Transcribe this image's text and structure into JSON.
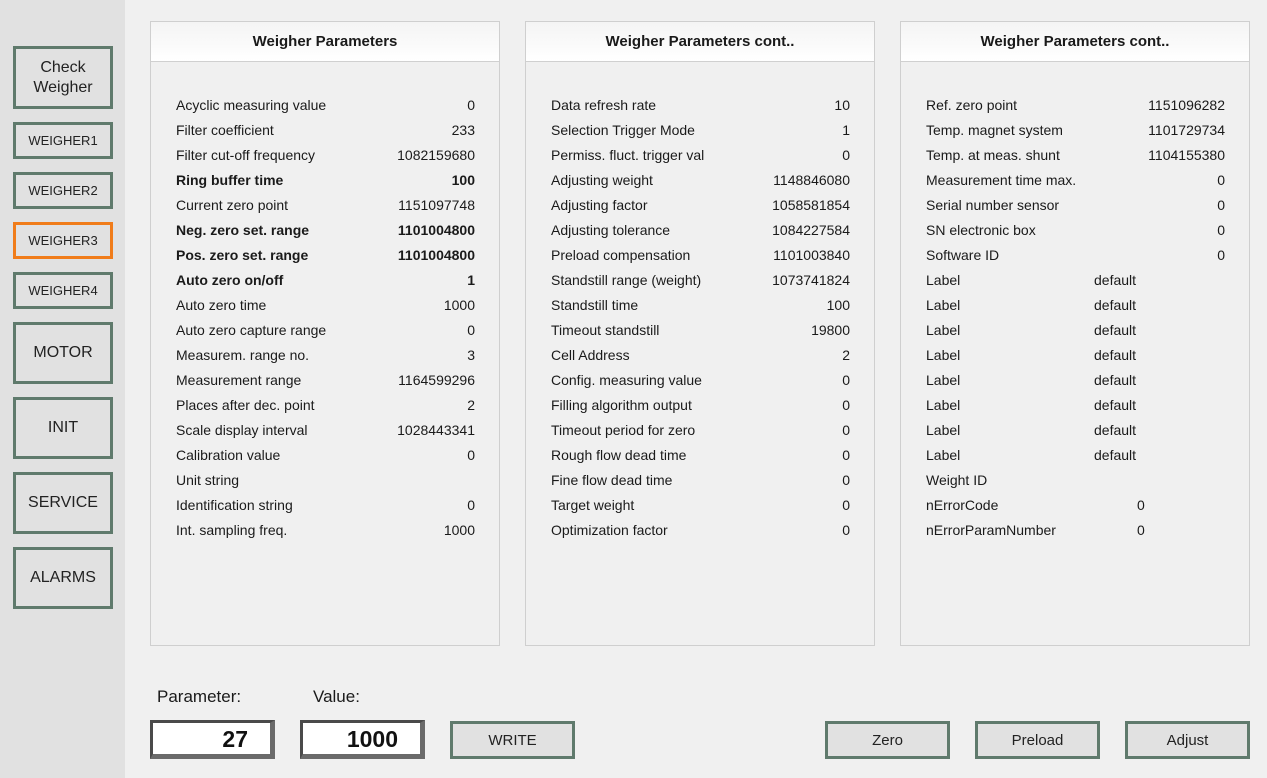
{
  "sidebar": {
    "check_weigher": "Check\nWeigher",
    "weigher1": "WEIGHER1",
    "weigher2": "WEIGHER2",
    "weigher3": "WEIGHER3",
    "weigher4": "WEIGHER4",
    "motor": "MOTOR",
    "init": "INIT",
    "service": "SERVICE",
    "alarms": "ALARMS",
    "active": "WEIGHER3",
    "active_color": "#f07c1a",
    "border_color": "#5f7a6c"
  },
  "panels": [
    {
      "title": "Weigher Parameters",
      "rows": [
        {
          "label": "Acyclic measuring value",
          "value": "0"
        },
        {
          "label": "Filter coefficient",
          "value": "233"
        },
        {
          "label": "Filter cut-off frequency",
          "value": "1082159680"
        },
        {
          "label": "Ring buffer time",
          "value": "100",
          "bold": true
        },
        {
          "label": "Current zero point",
          "value": "1151097748"
        },
        {
          "label": "Neg. zero set. range",
          "value": "1101004800",
          "bold": true
        },
        {
          "label": "Pos. zero set. range",
          "value": "1101004800",
          "bold": true
        },
        {
          "label": "Auto zero on/off",
          "value": "1",
          "bold": true
        },
        {
          "label": "Auto zero time",
          "value": "1000"
        },
        {
          "label": "Auto zero capture range",
          "value": "0"
        },
        {
          "label": "Measurem. range no.",
          "value": "3"
        },
        {
          "label": "Measurement range",
          "value": "1164599296"
        },
        {
          "label": "Places after dec. point",
          "value": "2"
        },
        {
          "label": "Scale display interval",
          "value": "1028443341"
        },
        {
          "label": "Calibration value",
          "value": "0"
        },
        {
          "label": "Unit string",
          "value": ""
        },
        {
          "label": "Identification string",
          "value": "0"
        },
        {
          "label": "Int. sampling freq.",
          "value": "1000"
        }
      ]
    },
    {
      "title": "Weigher Parameters cont..",
      "rows": [
        {
          "label": "Data refresh rate",
          "value": "10"
        },
        {
          "label": "Selection Trigger Mode",
          "value": "1"
        },
        {
          "label": "Permiss. fluct. trigger val",
          "value": "0"
        },
        {
          "label": "Adjusting weight",
          "value": "1148846080"
        },
        {
          "label": "Adjusting factor",
          "value": "1058581854"
        },
        {
          "label": "Adjusting tolerance",
          "value": "1084227584"
        },
        {
          "label": "Preload compensation",
          "value": "1101003840"
        },
        {
          "label": "Standstill range (weight)",
          "value": "1073741824"
        },
        {
          "label": "Standstill time",
          "value": "100"
        },
        {
          "label": "Timeout standstill",
          "value": "19800"
        },
        {
          "label": "Cell Address",
          "value": "2"
        },
        {
          "label": "Config. measuring value",
          "value": "0"
        },
        {
          "label": "Filling algorithm output",
          "value": "0"
        },
        {
          "label": "Timeout period for zero",
          "value": "0"
        },
        {
          "label": "Rough flow dead time",
          "value": "0"
        },
        {
          "label": "Fine flow dead time",
          "value": "0"
        },
        {
          "label": "Target weight",
          "value": "0"
        },
        {
          "label": "Optimization factor",
          "value": "0"
        }
      ]
    },
    {
      "title": "Weigher Parameters cont..",
      "rows": [
        {
          "label": "Ref. zero point",
          "value": "1151096282"
        },
        {
          "label": "Temp. magnet system",
          "value": "1101729734"
        },
        {
          "label": "Temp. at meas. shunt",
          "value": "1104155380"
        },
        {
          "label": "Measurement time max.",
          "value": "0"
        },
        {
          "label": "Serial number sensor",
          "value": "0"
        },
        {
          "label": "SN electronic box",
          "value": "0"
        },
        {
          "label": "Software ID",
          "value": "0"
        },
        {
          "label": "Label",
          "value": "default",
          "align": "mid"
        },
        {
          "label": "Label",
          "value": "default",
          "align": "mid"
        },
        {
          "label": "Label",
          "value": "default",
          "align": "mid"
        },
        {
          "label": "Label",
          "value": "default",
          "align": "mid"
        },
        {
          "label": "Label",
          "value": "default",
          "align": "mid"
        },
        {
          "label": "Label",
          "value": "default",
          "align": "mid"
        },
        {
          "label": "Label",
          "value": "default",
          "align": "mid"
        },
        {
          "label": "Label",
          "value": "default",
          "align": "mid"
        },
        {
          "label": "Weight ID",
          "value": ""
        },
        {
          "label": "nErrorCode",
          "value": "0",
          "align": "mid2"
        },
        {
          "label": "nErrorParamNumber",
          "value": "0",
          "align": "mid2"
        }
      ]
    }
  ],
  "bottom": {
    "parameter_label": "Parameter:",
    "value_label": "Value:",
    "parameter_value": "27",
    "value_value": "1000",
    "write_button": "WRITE",
    "zero_button": "Zero",
    "preload_button": "Preload",
    "adjust_button": "Adjust"
  }
}
